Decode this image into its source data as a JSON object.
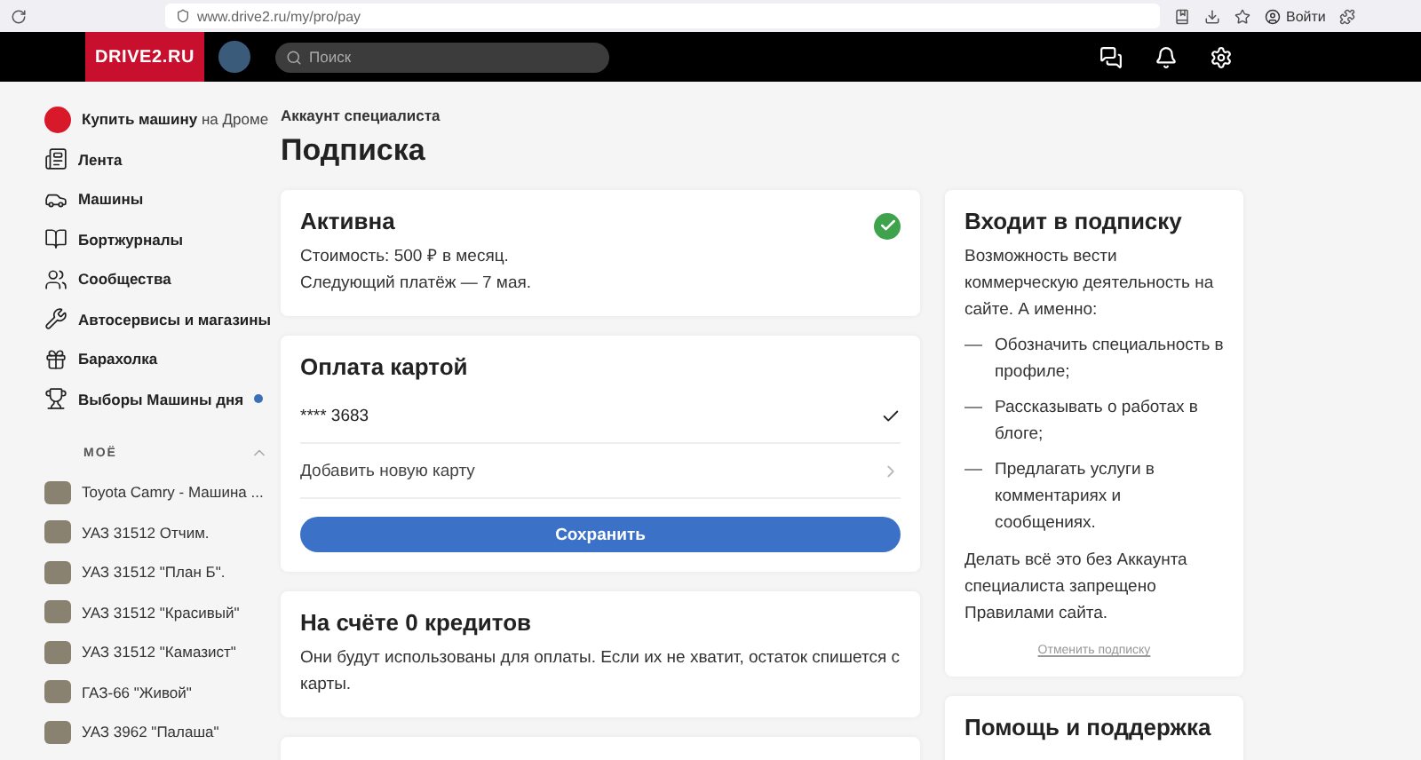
{
  "browser": {
    "address": "www.drive2.ru/my/pro/pay",
    "login": "Войти"
  },
  "header": {
    "logo": "DRIVE2.RU",
    "search": {
      "placeholder": "Поиск"
    }
  },
  "sidebar": {
    "items": [
      {
        "label": "Купить машину",
        "suffix": "на Дроме",
        "dot": false
      },
      {
        "label": "Лента",
        "dot": false
      },
      {
        "label": "Машины",
        "dot": false
      },
      {
        "label": "Бортжурналы",
        "dot": false
      },
      {
        "label": "Сообщества",
        "dot": false
      },
      {
        "label": "Автосервисы и магазины",
        "dot": false
      },
      {
        "label": "Барахолка",
        "dot": false
      },
      {
        "label": "Выборы Машины дня",
        "dot": true
      }
    ],
    "section": {
      "title": "МОЁ",
      "expanded": true
    },
    "cars": [
      "Toyota Camry - Машина ...",
      "УАЗ 31512 Отчим.",
      "УАЗ 31512 \"План Б\".",
      "УАЗ 31512 \"Красивый\"",
      "УАЗ 31512 \"Камазист\"",
      "ГАЗ-66 \"Живой\"",
      "УАЗ 3962 \"Палаша\""
    ]
  },
  "page": {
    "kicker": "Аккаунт специалиста",
    "title": "Подписка"
  },
  "status_card": {
    "title": "Активна",
    "active": true,
    "lines": [
      "Стоимость: 500 ₽ в месяц.",
      "Следующий платёж — 7 мая."
    ]
  },
  "payment_card": {
    "title": "Оплата картой",
    "options": [
      {
        "kind": "card",
        "label": "**** 3683",
        "selected": true
      },
      {
        "kind": "link",
        "label": "Добавить новую карту"
      }
    ],
    "button": "Сохранить"
  },
  "credits_card": {
    "title": "На счёте 0 кредитов",
    "text": "Они будут использованы для оплаты. Если их не хватит, остаток спишется с карты."
  },
  "includes_card": {
    "title": "Входит в подписку",
    "intro": "Возможность вести коммерческую деятельность на сайте. А именно:",
    "items": [
      "Обозначить специальность в профиле;",
      "Рассказывать о работах в блоге;",
      "Предлагать услуги в комментариях и сообщениях."
    ],
    "note": "Делать всё это без Аккаунта специалиста запрещено Правилами сайта.",
    "cancel": "Отменить подписку"
  },
  "help_card": {
    "title": "Помощь и поддержка"
  }
}
